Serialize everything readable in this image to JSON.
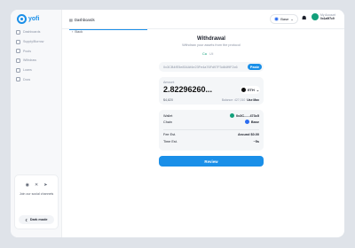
{
  "app": {
    "logo_text": "yofi"
  },
  "sidebar": {
    "items": [
      {
        "label": "Dashboards",
        "icon": "grid-icon"
      },
      {
        "label": "Supply/Borrow",
        "icon": "swap-icon"
      },
      {
        "label": "Pools",
        "icon": "pool-icon"
      },
      {
        "label": "Withdraw",
        "icon": "withdraw-icon"
      },
      {
        "label": "Loans",
        "icon": "loan-icon"
      },
      {
        "label": "Docs",
        "icon": "doc-icon"
      }
    ],
    "promo": {
      "text": "Join our social channels"
    },
    "dark_mode_label": "Dark mode"
  },
  "topbar": {
    "tab_label": "Dashboards",
    "network": "Base",
    "account": {
      "label": "My Account",
      "address": "0x1a9f7c9"
    }
  },
  "main": {
    "back_label": "Back",
    "title": "Withdrawal",
    "subtitle": "Withdraw your assets from the protocol",
    "toggle": {
      "a": "Ca",
      "b": "Uli"
    },
    "address": {
      "value": "0x3CB4fE5e834Af4e23Fe4a76Fd97F3d84f9F2c6",
      "paste_label": "Paste"
    },
    "amount": {
      "label": "Amount",
      "value": "2.82296260...",
      "token": "ETH",
      "usd": "$4,820",
      "balance": "Balance: 427,010",
      "max": "Use Max"
    },
    "details": [
      {
        "key": "Wallet",
        "value": "0x3C......473c5",
        "color": "#13a07b"
      },
      {
        "key": "Chain",
        "value": "Base",
        "color": "#2b6cf0"
      },
      {
        "key": "Fee Est.",
        "value": "Around $0.00"
      },
      {
        "key": "Time Est.",
        "value": "~5s"
      }
    ],
    "review_label": "Review"
  }
}
